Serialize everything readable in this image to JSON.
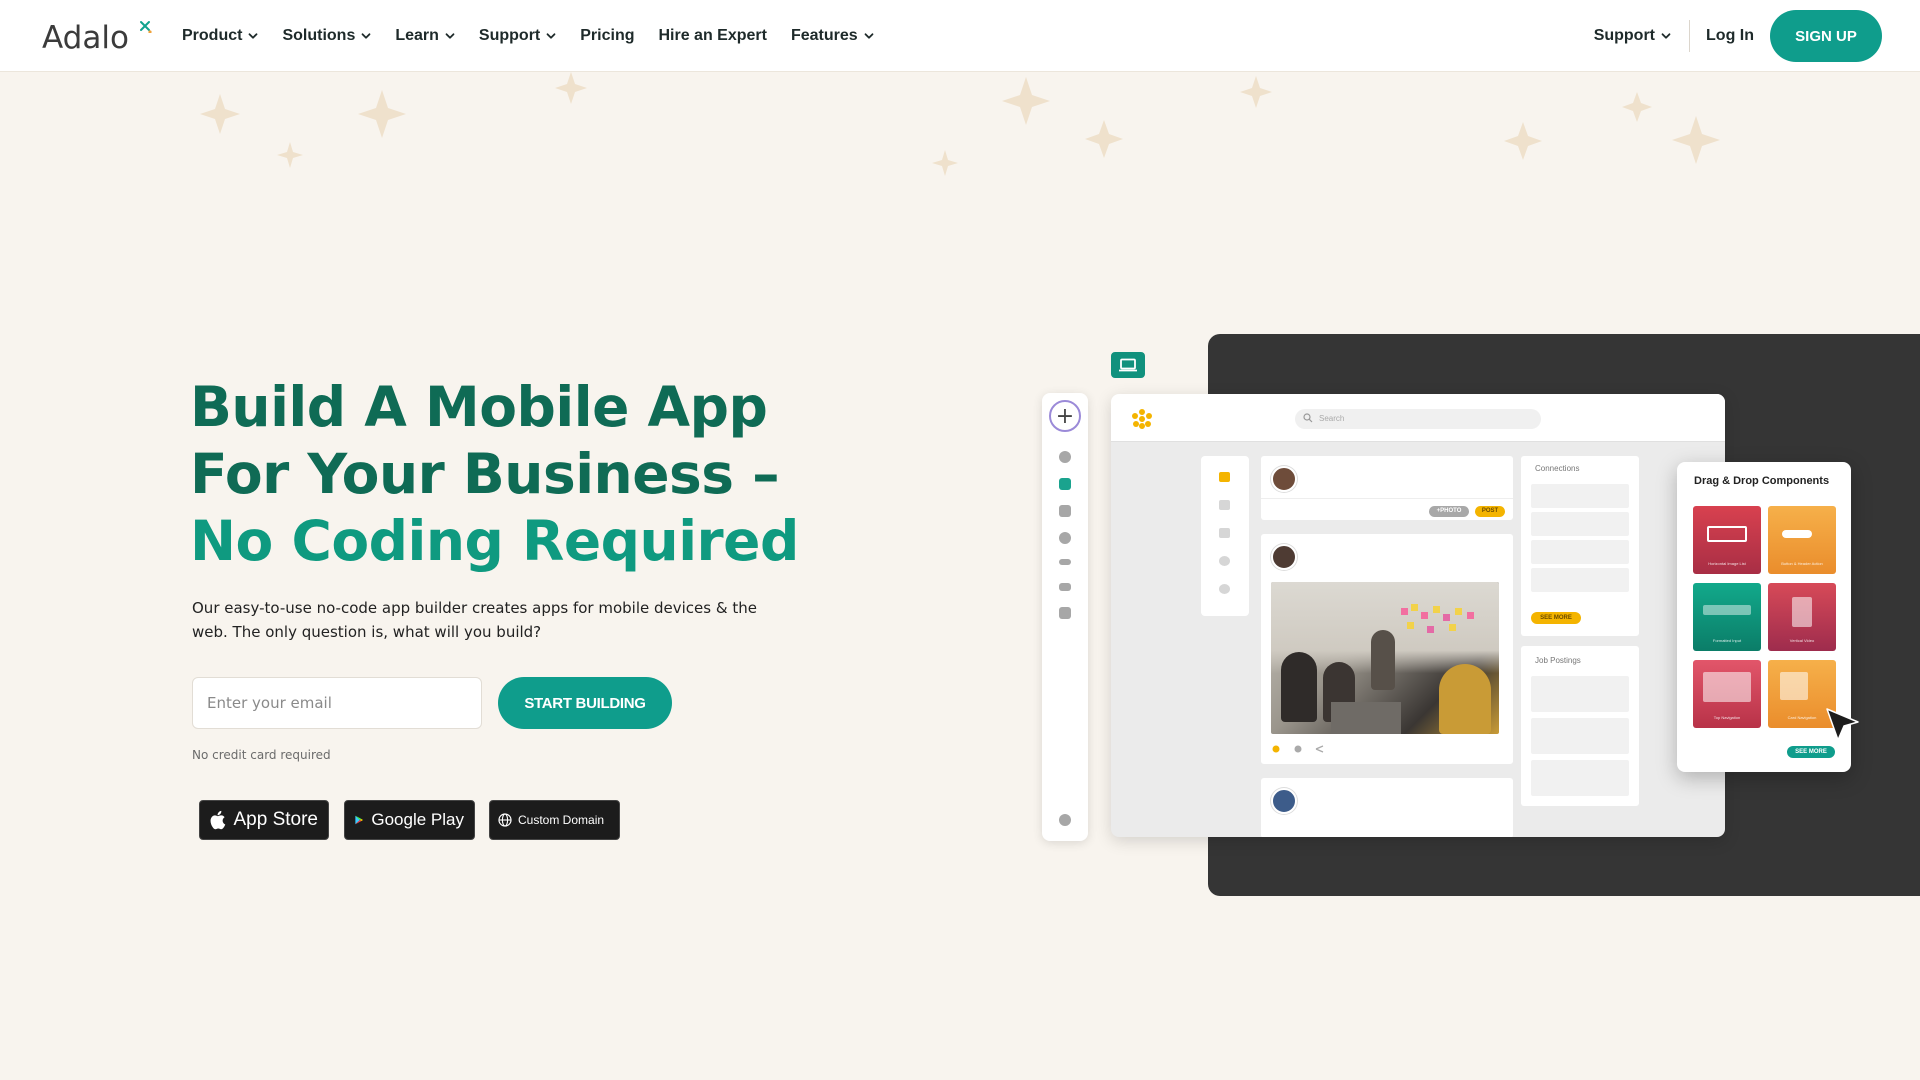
{
  "nav": {
    "logo": "Adalo",
    "items": [
      {
        "label": "Product",
        "dropdown": true
      },
      {
        "label": "Solutions",
        "dropdown": true
      },
      {
        "label": "Learn",
        "dropdown": true
      },
      {
        "label": "Support",
        "dropdown": true
      },
      {
        "label": "Pricing",
        "dropdown": false
      },
      {
        "label": "Hire an Expert",
        "dropdown": false
      },
      {
        "label": "Features",
        "dropdown": true
      }
    ],
    "right_support": "Support",
    "login": "Log In",
    "signup": "SIGN UP"
  },
  "hero": {
    "title_line1": "Build A Mobile App",
    "title_line2": "For Your Business –",
    "title_line3": "No Coding Required",
    "subtitle": "Our easy-to-use no-code app builder creates apps for mobile devices & the web. The only question is, what will you build?",
    "email_placeholder": "Enter your email",
    "cta": "START BUILDING",
    "note": "No credit card required"
  },
  "badges": {
    "app_store": "App Store",
    "google_play": "Google Play",
    "custom_domain": "Custom Domain"
  },
  "editor": {
    "search_placeholder": "Search",
    "photo_pill": "+PHOTO",
    "post_pill": "POST",
    "connections_title": "Connections",
    "job_postings_title": "Job Postings",
    "see_more": "SEE MORE",
    "components_title": "Drag & Drop Components",
    "tiles": [
      {
        "label": "Horizontal Image List",
        "color": "#c8384a"
      },
      {
        "label": "Button & Header Action",
        "color": "#f0a23a"
      },
      {
        "label": "Formatted Input",
        "color": "#0f9a80"
      },
      {
        "label": "Vertical Video",
        "color": "#c8384a"
      },
      {
        "label": "Top Navigation",
        "color": "#d64a5c"
      },
      {
        "label": "Card Navigation",
        "color": "#f0a23a"
      }
    ],
    "components_see_more": "SEE MORE"
  },
  "colors": {
    "brand_teal": "#0f9d8c",
    "title_dark": "#0f6b55",
    "title_light": "#0f9a80",
    "background": "#f8f4ee"
  }
}
